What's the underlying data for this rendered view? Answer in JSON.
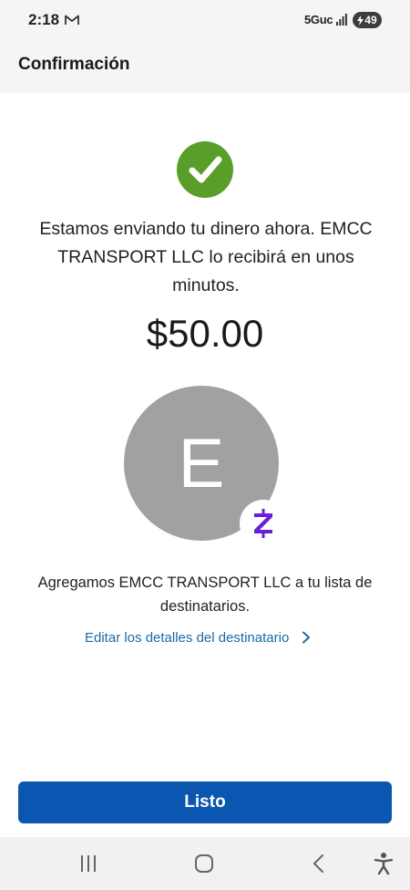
{
  "status_bar": {
    "time": "2:18",
    "network": "5Guc",
    "battery": "49"
  },
  "header": {
    "title": "Confirmación"
  },
  "confirmation": {
    "message": "Estamos enviando tu dinero ahora. EMCC TRANSPORT LLC lo recibirá en unos minutos.",
    "amount": "$50.00",
    "avatar_initial": "E",
    "added_message": "Agregamos EMCC TRANSPORT LLC a tu lista de destinatarios.",
    "edit_link": "Editar los detalles del destinatario"
  },
  "actions": {
    "done_label": "Listo"
  },
  "icons": {
    "success": "check-circle-icon",
    "zelle": "zelle-logo-icon",
    "gmail": "gmail-icon",
    "signal": "signal-icon",
    "recents": "recents-icon",
    "home": "home-icon",
    "back": "back-icon",
    "accessibility": "accessibility-icon"
  },
  "colors": {
    "success_green": "#5a9e2a",
    "primary_blue": "#0a56b0",
    "link_blue": "#1b6aa5",
    "zelle_purple": "#6d1ed4",
    "avatar_gray": "#a1a1a1"
  }
}
